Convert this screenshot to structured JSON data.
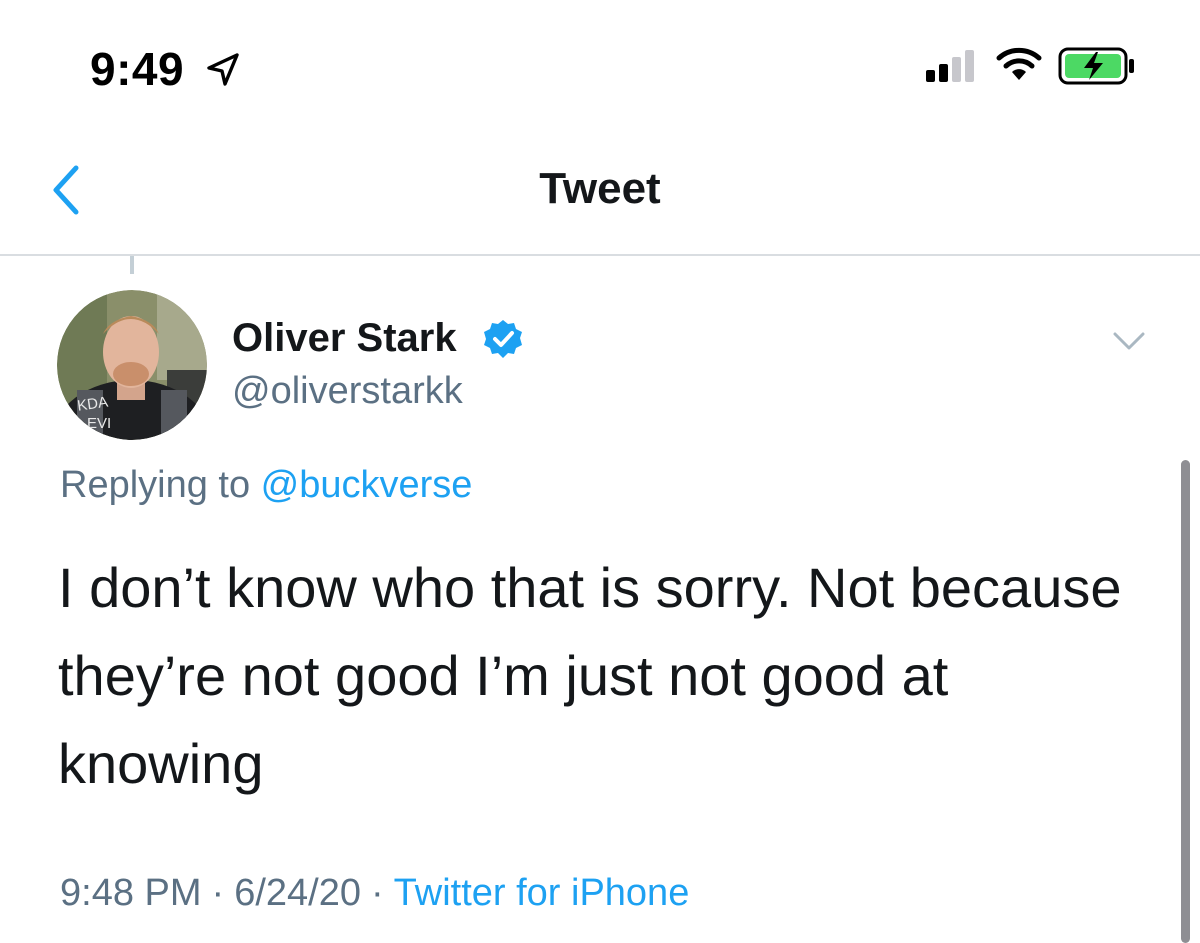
{
  "status_bar": {
    "time": "9:49",
    "icons": [
      "location-arrow-icon",
      "cellular-signal-icon",
      "wifi-icon",
      "battery-charging-icon"
    ],
    "battery_color": "#4cd964"
  },
  "nav": {
    "title": "Tweet",
    "back_icon": "chevron-left-icon",
    "accent": "#1da1f2"
  },
  "tweet": {
    "author": {
      "display_name": "Oliver Stark",
      "handle": "@oliverstarkk",
      "verified": true
    },
    "replying_prefix": "Replying to ",
    "replying_to": "@buckverse",
    "text": "I don’t know who that is sorry. Not because they’re not good I’m just not good at knowing",
    "time": "9:48 PM",
    "separator": "·",
    "date": "6/24/20",
    "source": "Twitter for iPhone"
  },
  "colors": {
    "primary_text": "#14171a",
    "secondary_text": "#5b7083",
    "link": "#1da1f2",
    "divider": "#d9dde1"
  }
}
